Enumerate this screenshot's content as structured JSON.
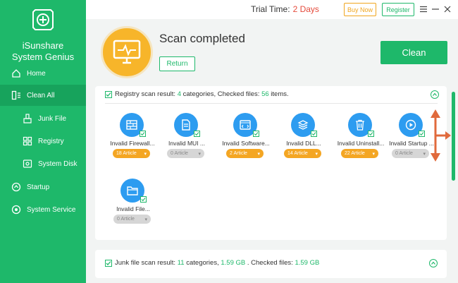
{
  "app": {
    "name_line1": "iSunshare",
    "name_line2": "System Genius"
  },
  "sidebar": {
    "items": [
      {
        "label": "Home",
        "icon": "home-icon"
      },
      {
        "label": "Clean All",
        "icon": "clean-all-icon"
      },
      {
        "label": "Junk File",
        "icon": "broom-icon"
      },
      {
        "label": "Registry",
        "icon": "registry-icon"
      },
      {
        "label": "System Disk",
        "icon": "disk-icon"
      },
      {
        "label": "Startup",
        "icon": "startup-icon"
      },
      {
        "label": "System Service",
        "icon": "service-icon"
      }
    ]
  },
  "topbar": {
    "trial_label": "Trial Time:",
    "trial_days": "2 Days",
    "buy_label": "Buy Now",
    "register_label": "Register"
  },
  "hero": {
    "title": "Scan completed",
    "return_label": "Return",
    "clean_label": "Clean"
  },
  "registry": {
    "prefix": "Registry scan result:",
    "categories": "4",
    "cat_text": "categories, Checked files:",
    "files": "56",
    "files_text": "items.",
    "items": [
      {
        "label": "Invalid Firewall...",
        "count": "18 Article",
        "icon": "firewall-icon"
      },
      {
        "label": "Invalid MUI ...",
        "count": "0 Article",
        "icon": "document-icon"
      },
      {
        "label": "Invalid Software...",
        "count": "2 Article",
        "icon": "software-icon"
      },
      {
        "label": "Invalid DLL...",
        "count": "14 Article",
        "icon": "layers-icon"
      },
      {
        "label": "Invalid Uninstall...",
        "count": "22 Article",
        "icon": "trash-icon"
      },
      {
        "label": "Invalid Startup ...",
        "count": "0 Article",
        "icon": "play-icon"
      },
      {
        "label": "Invalid File...",
        "count": "0 Article",
        "icon": "folder-icon"
      }
    ]
  },
  "junk": {
    "prefix": "Junk file scan result:",
    "categories": "11",
    "cat_text": "categories,",
    "size": "1.59 GB",
    "files_text": ". Checked files:",
    "files": "1.59 GB"
  },
  "colors": {
    "brand": "#1eb86a",
    "accent": "#f4a623",
    "icon_blue": "#2d9cf0",
    "alert": "#e54b3c"
  }
}
